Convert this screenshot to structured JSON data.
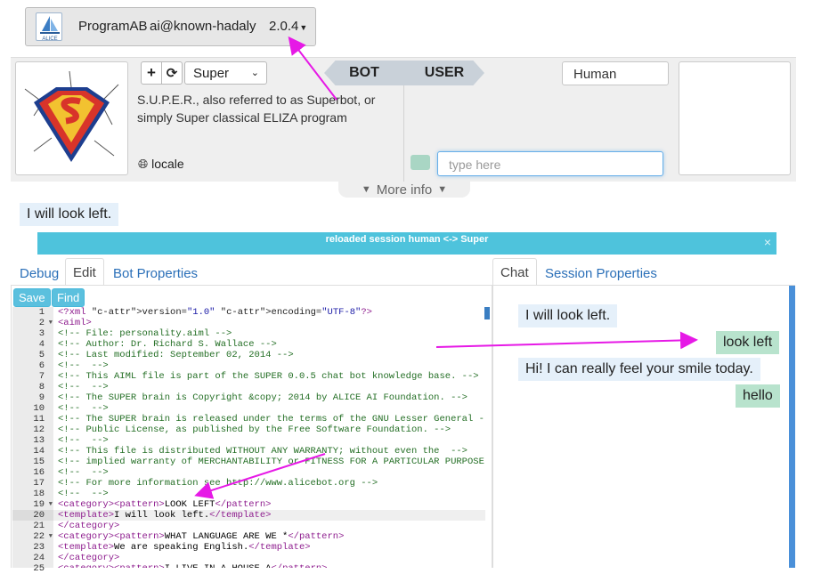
{
  "app": {
    "name": "ProgramAB",
    "user": "ai@known-hadaly",
    "version": "2.0.4",
    "logo_text": "ALICE"
  },
  "bot": {
    "add_icon": "plus-icon",
    "reload_icon": "refresh-icon",
    "selected": "Super",
    "description": "S.U.P.E.R., also referred to as Superbot, or simply Super classical ELIZA program",
    "locale_label": "locale",
    "locale_icon": "globe-icon"
  },
  "tabs_top": {
    "bot": "BOT",
    "user": "USER"
  },
  "user": {
    "name": "Human",
    "input_placeholder": "type here"
  },
  "more_info": "More info",
  "last_bot_message": "I will look left.",
  "alert": {
    "text": "reloaded session human <-> Super",
    "close": "×"
  },
  "left_tabs": [
    "Debug",
    "Edit",
    "Bot Properties"
  ],
  "right_tabs": [
    "Chat",
    "Session Properties"
  ],
  "toolbar": {
    "save": "Save",
    "find": "Find"
  },
  "editor": {
    "active_line": 20,
    "fold_lines": [
      2,
      19,
      22
    ],
    "lines": [
      "<?xml version=\"1.0\" encoding=\"UTF-8\"?>",
      "<aiml>",
      "<!-- File: personality.aiml -->",
      "<!-- Author: Dr. Richard S. Wallace -->",
      "<!-- Last modified: September 02, 2014 -->",
      "<!--  -->",
      "<!-- This AIML file is part of the SUPER 0.0.5 chat bot knowledge base. -->",
      "<!--  -->",
      "<!-- The SUPER brain is Copyright &copy; 2014 by ALICE AI Foundation. -->",
      "<!--  -->",
      "<!-- The SUPER brain is released under the terms of the GNU Lesser General -->",
      "<!-- Public License, as published by the Free Software Foundation. -->",
      "<!--  -->",
      "<!-- This file is distributed WITHOUT ANY WARRANTY; without even the  -->",
      "<!-- implied warranty of MERCHANTABILITY or FITNESS FOR A PARTICULAR PURPOSE. -->",
      "<!--  -->",
      "<!-- For more information see http://www.alicebot.org -->",
      "<!--  -->",
      "<category><pattern>LOOK LEFT</pattern>",
      "<template>I will look left.</template>",
      "</category>",
      "<category><pattern>WHAT LANGUAGE ARE WE *</pattern>",
      "<template>We are speaking English.</template>",
      "</category>",
      "<category><pattern>I LIVE IN A HOUSE A</pattern>"
    ]
  },
  "chat": [
    {
      "from": "bot",
      "text": "I will look left."
    },
    {
      "from": "user",
      "text": "look left"
    },
    {
      "from": "bot",
      "text": "Hi! I can really feel your smile today."
    },
    {
      "from": "user",
      "text": "hello"
    }
  ],
  "colors": {
    "accent": "#4ec3dc",
    "link": "#2a6fb8",
    "annotation_arrow": "#e619e6",
    "bot_bubble": "#e5f0fa",
    "user_bubble": "#b8e3cd"
  }
}
